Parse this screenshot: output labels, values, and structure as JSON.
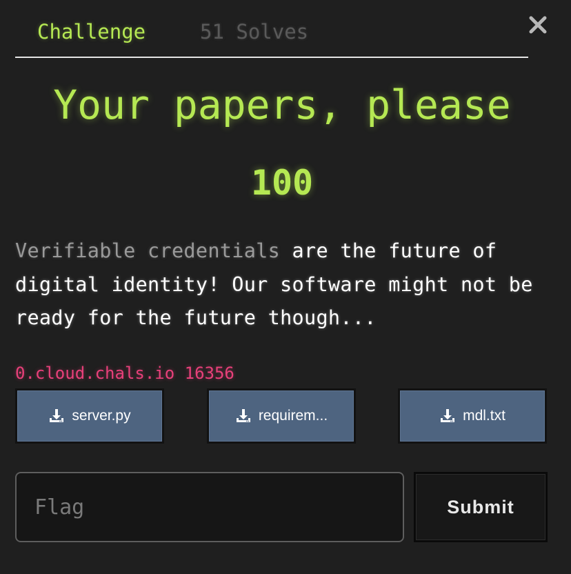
{
  "tabs": {
    "challenge_label": "Challenge",
    "solves_label": "51 Solves"
  },
  "close_icon": "close-icon",
  "challenge": {
    "title": "Your papers, please",
    "value": "100",
    "description_link": "Verifiable credentials",
    "description_text": " are the future of digital identity! Our software might not be ready for the future though...",
    "connection": "0.cloud.chals.io 16356"
  },
  "files": [
    {
      "label": "server.py",
      "icon": "download-icon"
    },
    {
      "label": "requirem...",
      "icon": "download-icon"
    },
    {
      "label": "mdl.txt",
      "icon": "download-icon"
    }
  ],
  "form": {
    "flag_placeholder": "Flag",
    "flag_value": "",
    "submit_label": "Submit"
  },
  "colors": {
    "accent": "#b5e853",
    "connection": "#e8407a",
    "file_button": "#4e6480",
    "background": "#1f1f1f"
  }
}
